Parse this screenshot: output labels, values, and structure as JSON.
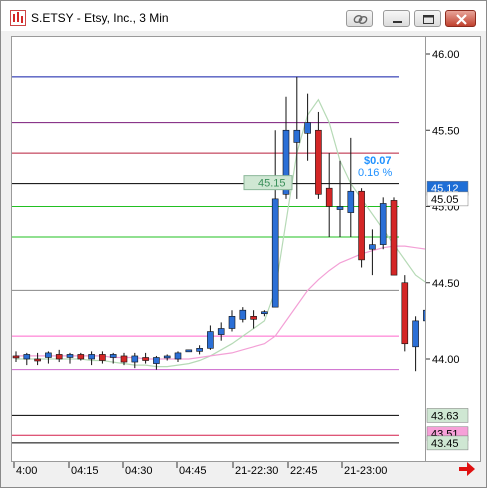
{
  "window": {
    "title": "S.ETSY - Etsy, Inc., 3 Min"
  },
  "colors": {
    "up_candle": "#2b6fd6",
    "down_candle": "#d42626",
    "accent_blue": "#1e90ff"
  },
  "icons": {
    "app": "chart-app-icon",
    "link": "link-icon",
    "minimize": "minimize-icon",
    "maximize": "maximize-icon",
    "close": "close-icon",
    "scroll_right": "red-right-arrow-icon"
  },
  "price_axis": {
    "ticks": [
      "46.00",
      "45.50",
      "45.00",
      "44.50",
      "44.00"
    ],
    "labels": {
      "last_price": "45.12",
      "price_2": "45.05",
      "level_low_1": "43.63",
      "level_low_2": "43.51",
      "level_low_3": "43.45"
    }
  },
  "time_axis": {
    "ticks": [
      "4:00",
      "04:15",
      "04:30",
      "04:45",
      "21-22:30",
      "22:45",
      "21-23:00"
    ]
  },
  "overlay": {
    "value_top": "$0.07",
    "value_pct": "0.16 %",
    "box_value": "45.15"
  },
  "chart_data": {
    "type": "candlestick",
    "y_axis_range": [
      43.4,
      46.2
    ],
    "candles": [
      {
        "o": 44.02,
        "h": 44.05,
        "l": 43.98,
        "c": 44.01
      },
      {
        "o": 44.0,
        "h": 44.04,
        "l": 43.96,
        "c": 44.03
      },
      {
        "o": 44.0,
        "h": 44.04,
        "l": 43.96,
        "c": 43.99
      },
      {
        "o": 44.01,
        "h": 44.05,
        "l": 43.97,
        "c": 44.04
      },
      {
        "o": 44.03,
        "h": 44.06,
        "l": 43.98,
        "c": 44.0
      },
      {
        "o": 44.01,
        "h": 44.04,
        "l": 43.97,
        "c": 44.03
      },
      {
        "o": 44.03,
        "h": 44.04,
        "l": 43.99,
        "c": 44.0
      },
      {
        "o": 44.0,
        "h": 44.05,
        "l": 43.96,
        "c": 44.03
      },
      {
        "o": 44.03,
        "h": 44.05,
        "l": 43.97,
        "c": 43.99
      },
      {
        "o": 44.01,
        "h": 44.04,
        "l": 43.97,
        "c": 44.03
      },
      {
        "o": 44.02,
        "h": 44.04,
        "l": 43.96,
        "c": 43.98
      },
      {
        "o": 43.98,
        "h": 44.04,
        "l": 43.94,
        "c": 44.02
      },
      {
        "o": 44.01,
        "h": 44.04,
        "l": 43.97,
        "c": 43.99
      },
      {
        "o": 43.97,
        "h": 44.02,
        "l": 43.93,
        "c": 44.01
      },
      {
        "o": 44.01,
        "h": 44.03,
        "l": 43.99,
        "c": 44.02
      },
      {
        "o": 44.0,
        "h": 44.05,
        "l": 43.98,
        "c": 44.04
      },
      {
        "o": 44.06,
        "h": 44.06,
        "l": 44.05,
        "c": 44.06
      },
      {
        "o": 44.05,
        "h": 44.09,
        "l": 44.03,
        "c": 44.07
      },
      {
        "o": 44.07,
        "h": 44.22,
        "l": 44.06,
        "c": 44.18
      },
      {
        "o": 44.16,
        "h": 44.24,
        "l": 44.12,
        "c": 44.2
      },
      {
        "o": 44.2,
        "h": 44.32,
        "l": 44.18,
        "c": 44.28
      },
      {
        "o": 44.26,
        "h": 44.34,
        "l": 44.24,
        "c": 44.32
      },
      {
        "o": 44.28,
        "h": 44.32,
        "l": 44.2,
        "c": 44.26
      },
      {
        "o": 44.3,
        "h": 44.32,
        "l": 44.28,
        "c": 44.31
      },
      {
        "o": 44.34,
        "h": 45.5,
        "l": 44.34,
        "c": 45.05
      },
      {
        "o": 45.08,
        "h": 45.72,
        "l": 45.05,
        "c": 45.5
      },
      {
        "o": 45.42,
        "h": 45.85,
        "l": 45.05,
        "c": 45.5
      },
      {
        "o": 45.48,
        "h": 45.74,
        "l": 45.3,
        "c": 45.55
      },
      {
        "o": 45.5,
        "h": 45.62,
        "l": 45.05,
        "c": 45.08
      },
      {
        "o": 45.12,
        "h": 45.35,
        "l": 44.8,
        "c": 45.0
      },
      {
        "o": 44.98,
        "h": 45.3,
        "l": 44.8,
        "c": 45.0
      },
      {
        "o": 44.96,
        "h": 45.45,
        "l": 44.8,
        "c": 45.1
      },
      {
        "o": 45.1,
        "h": 45.12,
        "l": 44.6,
        "c": 44.65
      },
      {
        "o": 44.72,
        "h": 44.85,
        "l": 44.55,
        "c": 44.75
      },
      {
        "o": 44.75,
        "h": 45.06,
        "l": 44.72,
        "c": 45.02
      },
      {
        "o": 45.04,
        "h": 45.06,
        "l": 44.55,
        "c": 44.55
      },
      {
        "o": 44.5,
        "h": 44.55,
        "l": 44.05,
        "c": 44.1
      },
      {
        "o": 44.08,
        "h": 44.28,
        "l": 43.92,
        "c": 44.25
      },
      {
        "o": 44.25,
        "h": 44.47,
        "l": 44.2,
        "c": 44.32
      },
      {
        "o": 44.32,
        "h": 44.52,
        "l": 43.88,
        "c": 43.88
      }
    ],
    "levels": [
      {
        "price": 45.85,
        "color": "#0d1aa8"
      },
      {
        "price": 45.55,
        "color": "#7a1a7a"
      },
      {
        "price": 45.35,
        "color": "#b81e3a"
      },
      {
        "price": 45.15,
        "color": "#000000"
      },
      {
        "price": 45.0,
        "color": "#22c022"
      },
      {
        "price": 44.8,
        "color": "#22c022"
      },
      {
        "price": 44.45,
        "color": "#888888"
      },
      {
        "price": 44.15,
        "color": "#ff66cc"
      },
      {
        "price": 43.93,
        "color": "#cc66cc"
      },
      {
        "price": 43.63,
        "color": "#000000"
      },
      {
        "price": 43.5,
        "color": "#d41e4a"
      },
      {
        "price": 43.45,
        "color": "#000000"
      }
    ]
  }
}
